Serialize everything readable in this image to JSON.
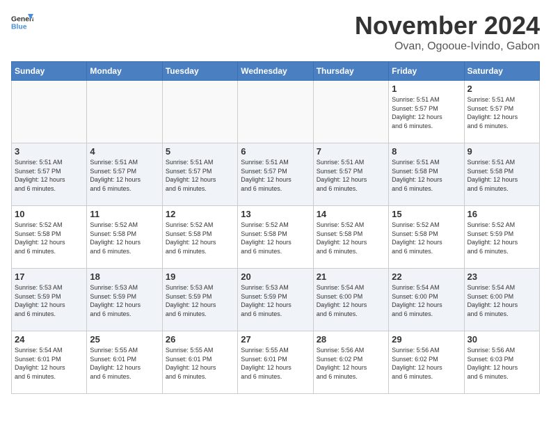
{
  "header": {
    "logo_line1": "General",
    "logo_line2": "Blue",
    "month": "November 2024",
    "location": "Ovan, Ogooue-Ivindo, Gabon"
  },
  "weekdays": [
    "Sunday",
    "Monday",
    "Tuesday",
    "Wednesday",
    "Thursday",
    "Friday",
    "Saturday"
  ],
  "weeks": [
    [
      {
        "day": "",
        "info": ""
      },
      {
        "day": "",
        "info": ""
      },
      {
        "day": "",
        "info": ""
      },
      {
        "day": "",
        "info": ""
      },
      {
        "day": "",
        "info": ""
      },
      {
        "day": "1",
        "info": "Sunrise: 5:51 AM\nSunset: 5:57 PM\nDaylight: 12 hours\nand 6 minutes."
      },
      {
        "day": "2",
        "info": "Sunrise: 5:51 AM\nSunset: 5:57 PM\nDaylight: 12 hours\nand 6 minutes."
      }
    ],
    [
      {
        "day": "3",
        "info": "Sunrise: 5:51 AM\nSunset: 5:57 PM\nDaylight: 12 hours\nand 6 minutes."
      },
      {
        "day": "4",
        "info": "Sunrise: 5:51 AM\nSunset: 5:57 PM\nDaylight: 12 hours\nand 6 minutes."
      },
      {
        "day": "5",
        "info": "Sunrise: 5:51 AM\nSunset: 5:57 PM\nDaylight: 12 hours\nand 6 minutes."
      },
      {
        "day": "6",
        "info": "Sunrise: 5:51 AM\nSunset: 5:57 PM\nDaylight: 12 hours\nand 6 minutes."
      },
      {
        "day": "7",
        "info": "Sunrise: 5:51 AM\nSunset: 5:57 PM\nDaylight: 12 hours\nand 6 minutes."
      },
      {
        "day": "8",
        "info": "Sunrise: 5:51 AM\nSunset: 5:58 PM\nDaylight: 12 hours\nand 6 minutes."
      },
      {
        "day": "9",
        "info": "Sunrise: 5:51 AM\nSunset: 5:58 PM\nDaylight: 12 hours\nand 6 minutes."
      }
    ],
    [
      {
        "day": "10",
        "info": "Sunrise: 5:52 AM\nSunset: 5:58 PM\nDaylight: 12 hours\nand 6 minutes."
      },
      {
        "day": "11",
        "info": "Sunrise: 5:52 AM\nSunset: 5:58 PM\nDaylight: 12 hours\nand 6 minutes."
      },
      {
        "day": "12",
        "info": "Sunrise: 5:52 AM\nSunset: 5:58 PM\nDaylight: 12 hours\nand 6 minutes."
      },
      {
        "day": "13",
        "info": "Sunrise: 5:52 AM\nSunset: 5:58 PM\nDaylight: 12 hours\nand 6 minutes."
      },
      {
        "day": "14",
        "info": "Sunrise: 5:52 AM\nSunset: 5:58 PM\nDaylight: 12 hours\nand 6 minutes."
      },
      {
        "day": "15",
        "info": "Sunrise: 5:52 AM\nSunset: 5:58 PM\nDaylight: 12 hours\nand 6 minutes."
      },
      {
        "day": "16",
        "info": "Sunrise: 5:52 AM\nSunset: 5:59 PM\nDaylight: 12 hours\nand 6 minutes."
      }
    ],
    [
      {
        "day": "17",
        "info": "Sunrise: 5:53 AM\nSunset: 5:59 PM\nDaylight: 12 hours\nand 6 minutes."
      },
      {
        "day": "18",
        "info": "Sunrise: 5:53 AM\nSunset: 5:59 PM\nDaylight: 12 hours\nand 6 minutes."
      },
      {
        "day": "19",
        "info": "Sunrise: 5:53 AM\nSunset: 5:59 PM\nDaylight: 12 hours\nand 6 minutes."
      },
      {
        "day": "20",
        "info": "Sunrise: 5:53 AM\nSunset: 5:59 PM\nDaylight: 12 hours\nand 6 minutes."
      },
      {
        "day": "21",
        "info": "Sunrise: 5:54 AM\nSunset: 6:00 PM\nDaylight: 12 hours\nand 6 minutes."
      },
      {
        "day": "22",
        "info": "Sunrise: 5:54 AM\nSunset: 6:00 PM\nDaylight: 12 hours\nand 6 minutes."
      },
      {
        "day": "23",
        "info": "Sunrise: 5:54 AM\nSunset: 6:00 PM\nDaylight: 12 hours\nand 6 minutes."
      }
    ],
    [
      {
        "day": "24",
        "info": "Sunrise: 5:54 AM\nSunset: 6:01 PM\nDaylight: 12 hours\nand 6 minutes."
      },
      {
        "day": "25",
        "info": "Sunrise: 5:55 AM\nSunset: 6:01 PM\nDaylight: 12 hours\nand 6 minutes."
      },
      {
        "day": "26",
        "info": "Sunrise: 5:55 AM\nSunset: 6:01 PM\nDaylight: 12 hours\nand 6 minutes."
      },
      {
        "day": "27",
        "info": "Sunrise: 5:55 AM\nSunset: 6:01 PM\nDaylight: 12 hours\nand 6 minutes."
      },
      {
        "day": "28",
        "info": "Sunrise: 5:56 AM\nSunset: 6:02 PM\nDaylight: 12 hours\nand 6 minutes."
      },
      {
        "day": "29",
        "info": "Sunrise: 5:56 AM\nSunset: 6:02 PM\nDaylight: 12 hours\nand 6 minutes."
      },
      {
        "day": "30",
        "info": "Sunrise: 5:56 AM\nSunset: 6:03 PM\nDaylight: 12 hours\nand 6 minutes."
      }
    ]
  ]
}
